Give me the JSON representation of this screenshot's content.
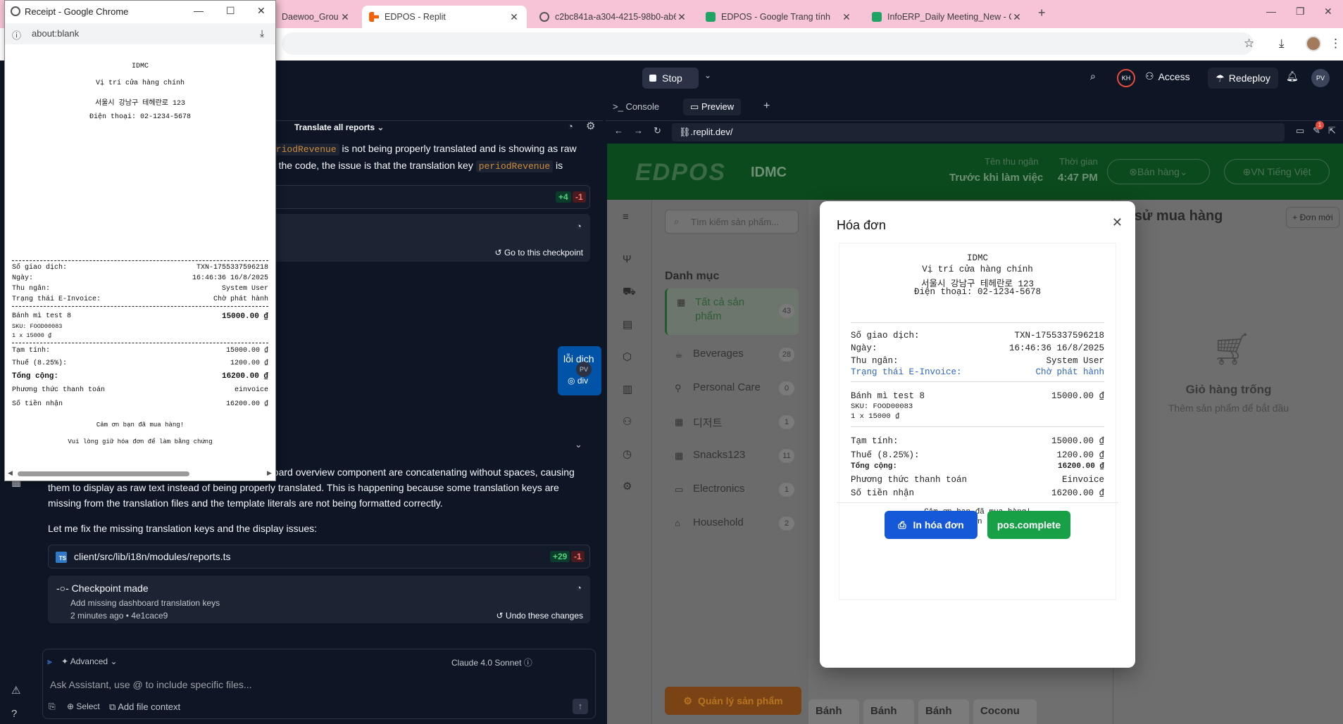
{
  "browser": {
    "tabs": [
      {
        "title": "Daewoo_Grou",
        "icon": "globe-icon"
      },
      {
        "title": "EDPOS - Replit",
        "icon": "replit-icon"
      },
      {
        "title": "c2bc841a-a304-4215-98b0-ab6",
        "icon": "globe-icon"
      },
      {
        "title": "EDPOS - Google Trang tính",
        "icon": "sheets-icon"
      },
      {
        "title": "InfoERP_Daily Meeting_New - C",
        "icon": "sheets-icon"
      }
    ]
  },
  "replit": {
    "stop_label": "Stop",
    "access_label": "Access",
    "redeploy_label": "Redeploy",
    "kh_initials": "KH",
    "pv_initials": "PV",
    "pane_tabs": [
      "Console",
      "Preview"
    ],
    "url": ".replit.dev/"
  },
  "agent": {
    "header_title": "Translate all reports",
    "msg1_code1": "eriodRevenue",
    "msg1_text1": " is not being properly translated and is showing as raw",
    "msg1_text2": "at the code, the issue is that the translation key ",
    "msg1_code2": "periodRevenue",
    "msg1_text3": " is",
    "diff1_add": "+4",
    "diff1_del": "-1",
    "go_checkpoint": "Go to this checkpoint",
    "user_bubble_text": "lỗi dịch",
    "user_bubble_tag": "div",
    "user_initials": "PV",
    "msg2_line1": "board overview component are concatenating without spaces, causing",
    "msg2_line2": "them to display as raw text instead of being properly translated. This is happening because some translation keys are",
    "msg2_line3": "missing from the translation files and the template literals are not being formatted correctly.",
    "msg3": "Let me fix the missing translation keys and the display issues:",
    "file_name": "client/src/lib/i18n/modules/reports.ts",
    "diff2_add": "+29",
    "diff2_del": "-1",
    "checkpoint_title": "Checkpoint made",
    "checkpoint_sub": "Add missing dashboard translation keys",
    "checkpoint_time": "2 minutes ago",
    "checkpoint_hash": "4e1cace9",
    "undo_label": "Undo these changes",
    "advanced_label": "Advanced",
    "model_label": "Claude 4.0 Sonnet",
    "input_placeholder": "Ask Assistant, use @ to include specific files...",
    "select_label": "Select",
    "add_context_label": "Add file context"
  },
  "pos": {
    "logo": "EDPOS",
    "store": "IDMC",
    "cashier_label": "Tên thu ngân",
    "cashier_value": "Trước khi làm việc",
    "time_label": "Thời gian",
    "time_value": "4:47 PM",
    "sales_label": "Bán hàng",
    "lang_label": "VN  Tiếng Việt",
    "search_placeholder": "Tìm kiếm sản phẩm...",
    "category_title": "Danh mục",
    "categories": [
      {
        "name": "Tất cả sản phẩm",
        "count": "43"
      },
      {
        "name": "Beverages",
        "count": "28"
      },
      {
        "name": "Personal Care",
        "count": "0"
      },
      {
        "name": "디저트",
        "count": "1"
      },
      {
        "name": "Snacks123",
        "count": "11"
      },
      {
        "name": "Electronics",
        "count": "1"
      },
      {
        "name": "Household",
        "count": "2"
      }
    ],
    "manage_label": "Quản lý sản phẩm",
    "history_title": "h sử mua hàng",
    "new_order": "+ Đơn mới",
    "products": [
      "Bánh",
      "Bánh",
      "Bánh",
      "Coconu"
    ],
    "empty_cart_title": "Giỏ hàng trống",
    "empty_cart_sub": "Thêm sản phẩm để bắt đầu"
  },
  "modal": {
    "title": "Hóa đơn",
    "store": "IDMC",
    "location": "Vị trí cửa hàng chính",
    "address": "서울시 강남구 테헤란로 123",
    "phone": "Điện thoại: 02-1234-5678",
    "txn_label": "Số giao dịch:",
    "txn_value": "TXN-1755337596218",
    "date_label": "Ngày:",
    "date_value": "16:46:36 16/8/2025",
    "cashier_label": "Thu ngân:",
    "cashier_value": "System User",
    "einv_label": "Trạng thái E-Invoice:",
    "einv_value": "Chờ phát hành",
    "item_name": "Bánh mì test 8",
    "item_price": "15000.00 ₫",
    "item_sku": "SKU: FOOD00083",
    "item_qty": "1 x 15000 ₫",
    "subtotal_label": "Tạm tính:",
    "subtotal_value": "15000.00 ₫",
    "tax_label": "Thuế (8.25%):",
    "tax_value": "1200.00 ₫",
    "total_label": "Tổng cộng:",
    "total_value": "16200.00 ₫",
    "payment_label": "Phương thức thanh toán",
    "payment_value": "Einvoice",
    "received_label": "Số tiền nhận",
    "received_value": "16200.00 ₫",
    "thanks": "Cảm ơn bạn đã mua hàng!",
    "keep": "Vui lòng giữ hóa đơn để làm bằng chứng",
    "print_label": "In hóa đơn",
    "complete_label": "pos.complete"
  },
  "popup": {
    "title": "Receipt - Google Chrome",
    "url": "about:blank",
    "payment_value": "einvoice"
  }
}
